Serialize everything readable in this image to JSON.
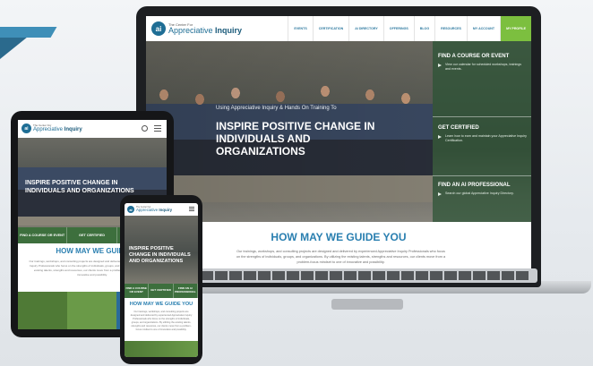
{
  "brand": {
    "logo_mark": "ai",
    "logo_small": "The Center For",
    "logo_name": "Appreciative",
    "logo_name_bold": "Inquiry"
  },
  "nav": {
    "items": [
      "EVENTS",
      "CERTIFICATION",
      "AI DIRECTORY",
      "OFFERINGS",
      "BLOG",
      "RESOURCES",
      "MY ACCOUNT"
    ],
    "cta": "MY PROFILE"
  },
  "hero": {
    "subtitle": "Using Appreciative Inquiry & Hands On Training To",
    "title": "INSPIRE POSITIVE CHANGE IN INDIVIDUALS AND ORGANIZATIONS",
    "title_tablet": "INSPIRE POSITIVE CHANGE IN INDIVIDUALS AND ORGANIZATIONS"
  },
  "sidebar": {
    "blocks": [
      {
        "heading": "FIND A COURSE OR EVENT",
        "text": "View our calendar for scheduled workshops, trainings and events."
      },
      {
        "heading": "GET CERTIFIED",
        "text": "Learn how to earn and maintain your Appreciative Inquiry Certification."
      },
      {
        "heading": "FIND AN AI PROFESSIONAL",
        "text": "Search our global Appreciative Inquiry Directory."
      }
    ]
  },
  "guide": {
    "title": "HOW MAY WE GUIDE YOU",
    "title_tablet": "HOW MAY WE GUIDE",
    "body": "Our trainings, workshops, and consulting projects are designed and delivered by experienced Appreciative Inquiry Professionals who focus on the strengths of individuals, groups, and organizations. By utilizing the existing talents, strengths and resources, our clients move from a problem-focus mindset to one of innovative and possibility."
  },
  "tablet_cta": [
    "FIND A COURSE OR EVENT",
    "GET CERTIFIED",
    ""
  ],
  "phone_cta": [
    "FIND A COURSE OR EVENT",
    "GET CERTIFIED",
    "FIND AN AI PROFESSIONAL"
  ],
  "colors": {
    "primary_blue": "#2a7fb0",
    "brand_green": "#7cbf3f",
    "dark_green": "#3d6f3d"
  }
}
